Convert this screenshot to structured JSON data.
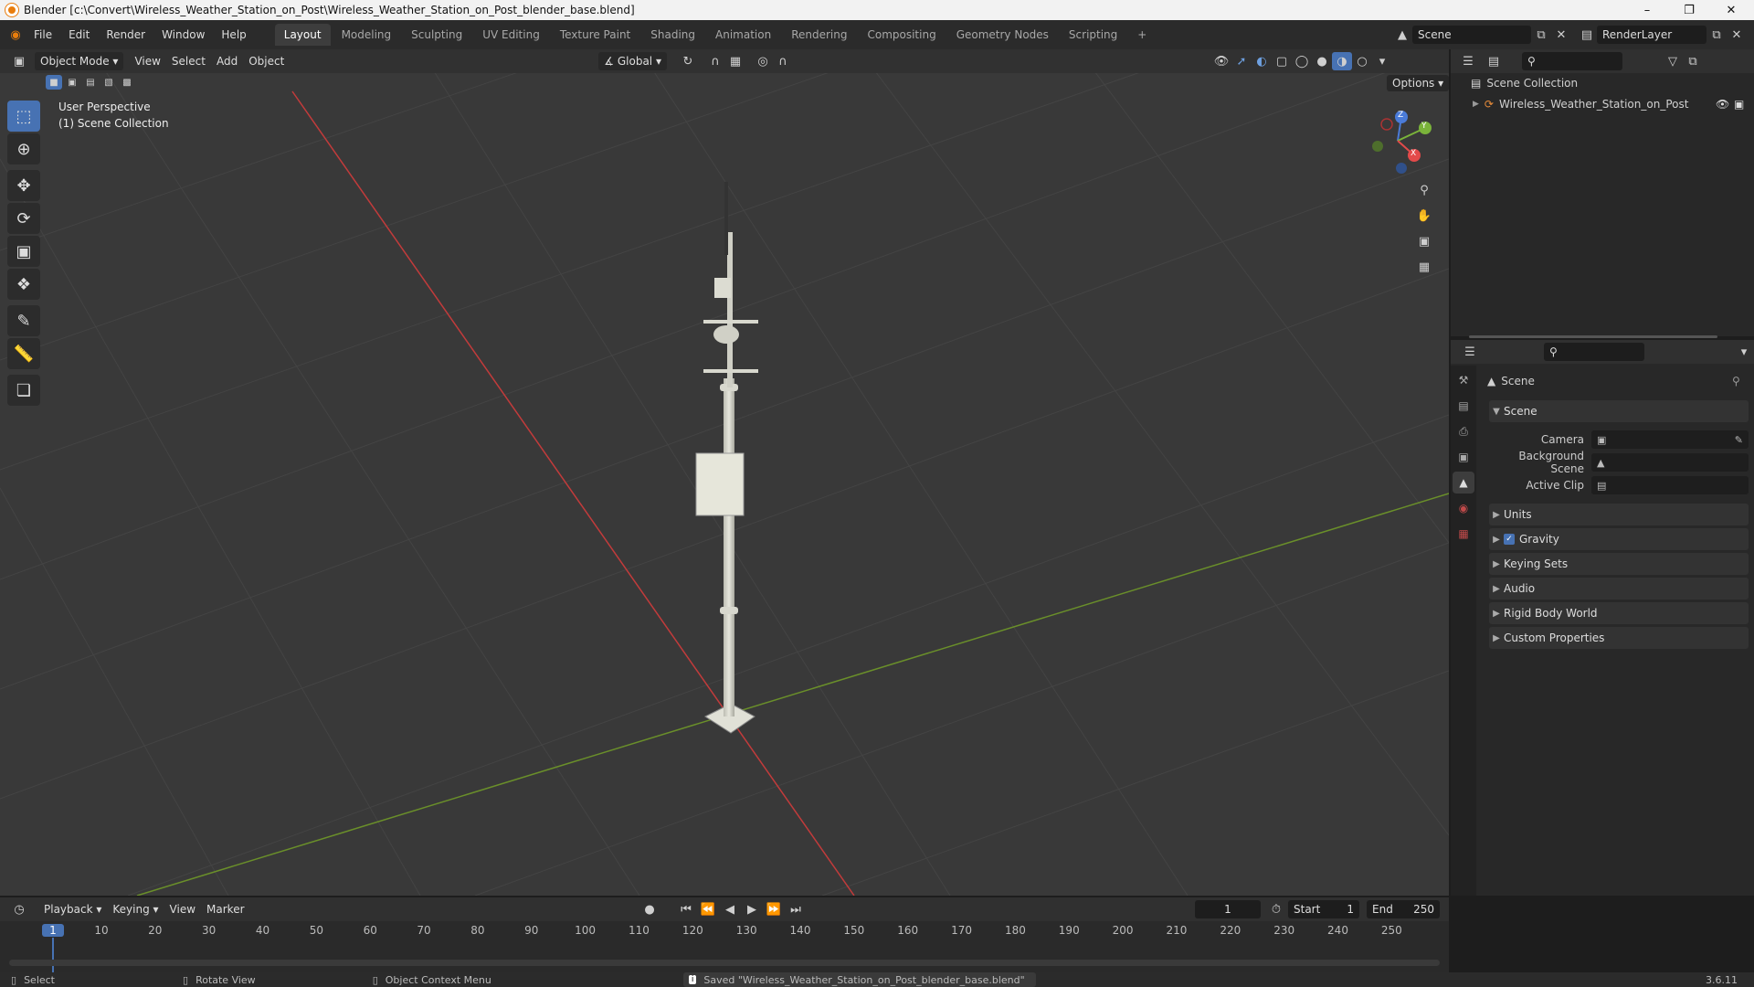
{
  "window": {
    "title": "Blender [c:\\Convert\\Wireless_Weather_Station_on_Post\\Wireless_Weather_Station_on_Post_blender_base.blend]"
  },
  "menubar": {
    "items": [
      "File",
      "Edit",
      "Render",
      "Window",
      "Help"
    ],
    "workspaces": [
      "Layout",
      "Modeling",
      "Sculpting",
      "UV Editing",
      "Texture Paint",
      "Shading",
      "Animation",
      "Rendering",
      "Compositing",
      "Geometry Nodes",
      "Scripting"
    ],
    "active_workspace": "Layout",
    "add_workspace": "+",
    "scene_name": "Scene",
    "view_layer": "RenderLayer"
  },
  "viewport": {
    "mode": "Object Mode",
    "menus": [
      "View",
      "Select",
      "Add",
      "Object"
    ],
    "transform_orientation": "Global",
    "options_label": "Options",
    "overlay_text_1": "User Perspective",
    "overlay_text_2": "(1) Scene Collection",
    "gizmo": {
      "x": "X",
      "y": "Y",
      "z": "Z"
    }
  },
  "toolbar": {
    "tools": [
      "select-box",
      "cursor",
      "move",
      "rotate",
      "scale",
      "transform",
      "annotate",
      "measure",
      "add-cube"
    ],
    "active_tool": "select-box"
  },
  "outliner": {
    "root": "Scene Collection",
    "items": [
      {
        "name": "Wireless_Weather_Station_on_Post",
        "visible": true
      }
    ]
  },
  "properties": {
    "context_title": "Scene",
    "section_scene": "Scene",
    "camera_label": "Camera",
    "background_scene_label": "Background Scene",
    "active_clip_label": "Active Clip",
    "panels": [
      "Units",
      "Gravity",
      "Keying Sets",
      "Audio",
      "Rigid Body World",
      "Custom Properties"
    ],
    "gravity_enabled": true
  },
  "timeline": {
    "menus": [
      "Playback",
      "Keying",
      "View",
      "Marker"
    ],
    "current_frame": "1",
    "start_label": "Start",
    "start_value": "1",
    "end_label": "End",
    "end_value": "250",
    "ruler_labels": [
      "1",
      "10",
      "20",
      "30",
      "40",
      "50",
      "60",
      "70",
      "80",
      "90",
      "100",
      "110",
      "120",
      "130",
      "140",
      "150",
      "160",
      "170",
      "180",
      "190",
      "200",
      "210",
      "220",
      "230",
      "240",
      "250"
    ]
  },
  "statusbar": {
    "select": "Select",
    "rotate_view": "Rotate View",
    "context_menu": "Object Context Menu",
    "message": "Saved \"Wireless_Weather_Station_on_Post_blender_base.blend\"",
    "version": "3.6.11"
  }
}
